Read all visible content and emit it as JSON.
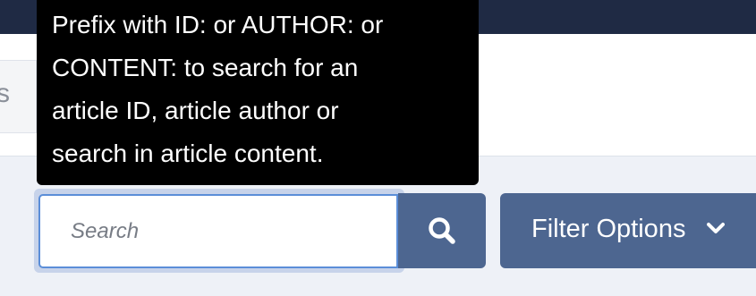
{
  "background_tab": {
    "label": "s"
  },
  "tooltip": {
    "lines": [
      "Prefix with ID: or AUTHOR: or",
      "CONTENT: to search for an",
      "article ID, article author or",
      "search in article content."
    ]
  },
  "search": {
    "placeholder": "Search",
    "value": "",
    "button_icon": "search-icon"
  },
  "filter": {
    "label": "Filter Options",
    "icon": "chevron-down-icon"
  },
  "colors": {
    "top_bar": "#1f2a44",
    "button": "#4d6690",
    "input_focus": "#5b8ed8",
    "tooltip": "#000000"
  }
}
